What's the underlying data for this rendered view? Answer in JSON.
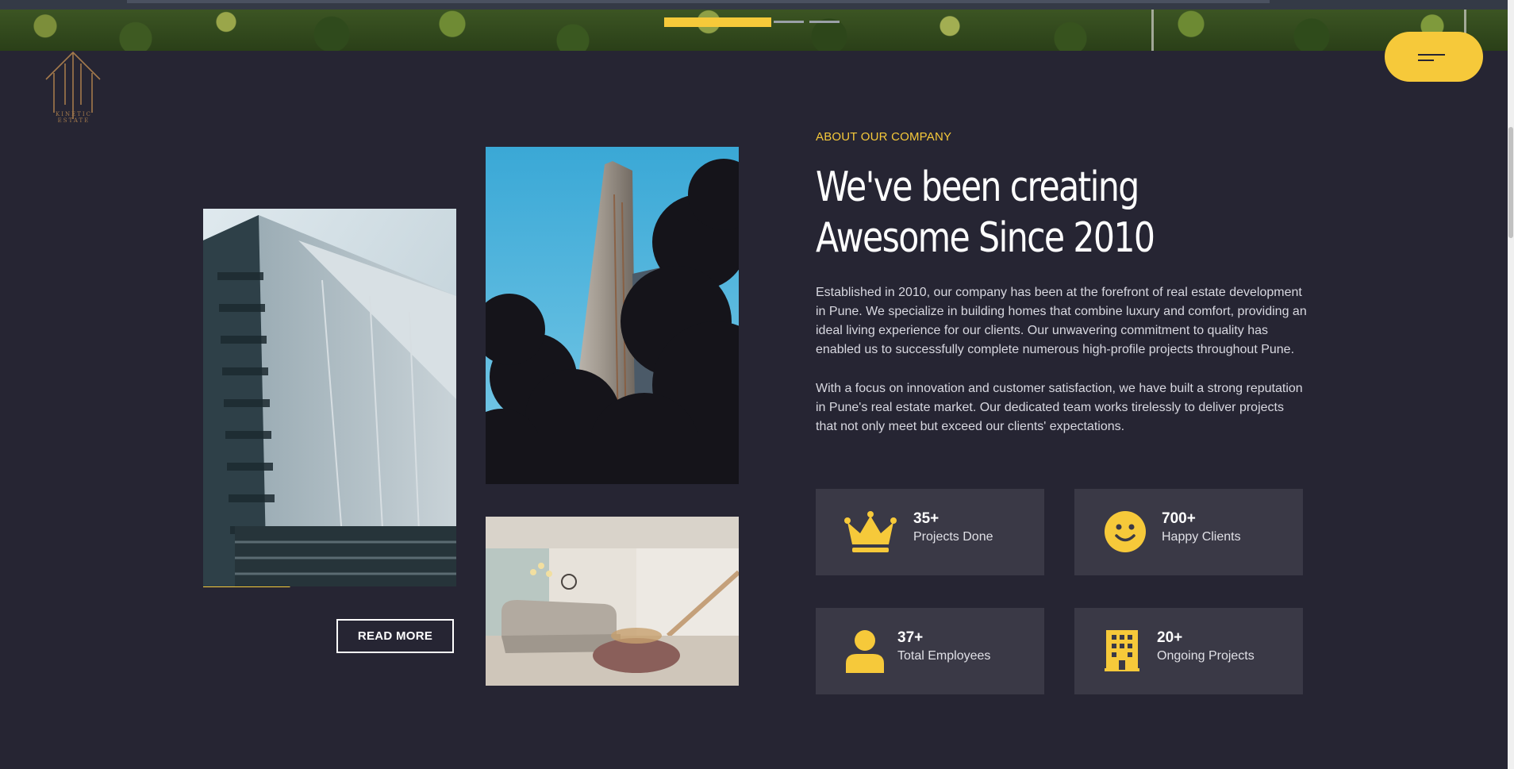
{
  "header": {
    "logo_text": "KINETIC ESTATE",
    "menu_icon": "menu-lines-icon"
  },
  "hero": {
    "slides_total": 3,
    "active_slide": 1
  },
  "about": {
    "eyebrow": "ABOUT OUR COMPANY",
    "headline_line1": "We've been creating",
    "headline_line2": "Awesome Since 2010",
    "paragraph1": "Established in 2010, our company has been at the forefront of real estate development in Pune. We specialize in building homes that combine luxury and comfort, providing an ideal living experience for our clients. Our unwavering commitment to quality has enabled us to successfully complete numerous high-profile projects throughout Pune.",
    "paragraph2": "With a focus on innovation and customer satisfaction, we have built a strong reputation in Pune's real estate market. Our dedicated team works tirelessly to deliver projects that not only meet but exceed our clients' expectations.",
    "read_more": "READ MORE"
  },
  "stats": [
    {
      "value": "35+",
      "label": "Projects Done",
      "icon": "crown-icon"
    },
    {
      "value": "700+",
      "label": "Happy Clients",
      "icon": "smiley-icon"
    },
    {
      "value": "37+",
      "label": "Total Employees",
      "icon": "user-icon"
    },
    {
      "value": "20+",
      "label": "Ongoing Projects",
      "icon": "building-icon"
    }
  ],
  "colors": {
    "background": "#262533",
    "accent": "#f6c93a",
    "card": "#3a3946"
  }
}
